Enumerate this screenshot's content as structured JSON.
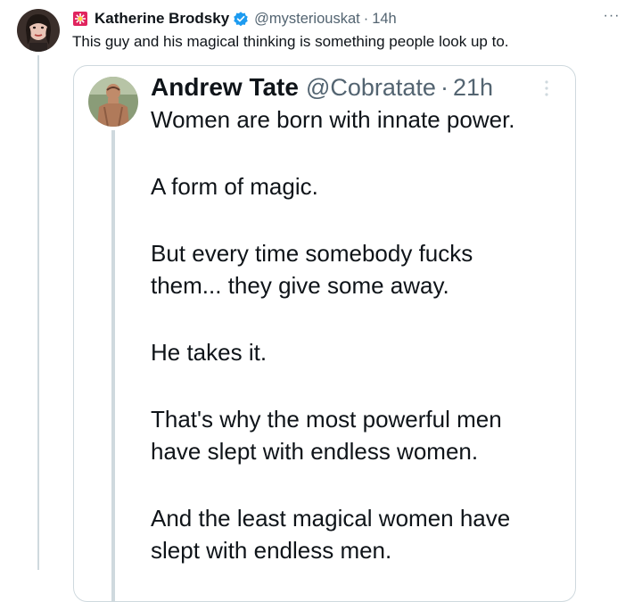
{
  "post": {
    "author": {
      "name": "Katherine Brodsky",
      "handle": "@mysteriouskat",
      "time": "14h",
      "separator": "·",
      "avatar_icon": "profile-photo",
      "prefix_icon": "siren-emoji-icon",
      "verified_icon": "verified-badge-icon",
      "verified_color": "#1d9bf0"
    },
    "text": "This guy and his magical thinking is something people look up to.",
    "more_label": "···"
  },
  "quote": {
    "author": {
      "name": "Andrew Tate",
      "handle": "@Cobratate",
      "separator": "·",
      "time": "21h",
      "avatar_icon": "profile-photo"
    },
    "lines": [
      "Women are born with innate power.",
      "",
      "A form of magic.",
      "",
      "But every time somebody fucks",
      "them... they give some away.",
      "",
      "He takes it.",
      "",
      "That's why the most powerful men",
      "have slept with endless women.",
      "",
      "And the least magical women have",
      "slept with endless men."
    ]
  },
  "colors": {
    "text_primary": "#0f1419",
    "text_secondary": "#536471",
    "border": "#cfd9de",
    "accent": "#1d9bf0",
    "siren_red": "#e0245e"
  }
}
